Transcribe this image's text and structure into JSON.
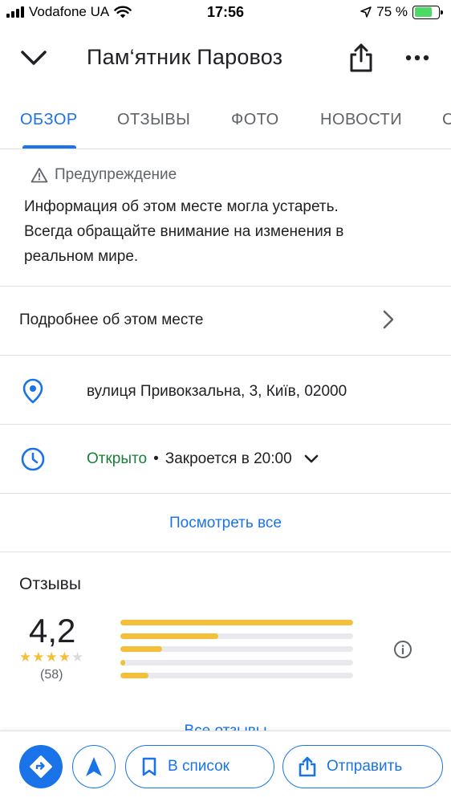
{
  "status_bar": {
    "carrier": "Vodafone UA",
    "time": "17:56",
    "battery_percent": "75 %",
    "battery_level": 0.75
  },
  "header": {
    "title": "Пам‘ятник Паровоз",
    "icons": [
      "chevron-down-icon",
      "share-icon",
      "more-icon"
    ]
  },
  "tabs": [
    {
      "label": "ОБЗОР",
      "active": true
    },
    {
      "label": "ОТЗЫВЫ",
      "active": false
    },
    {
      "label": "ФОТО",
      "active": false
    },
    {
      "label": "НОВОСТИ",
      "active": false
    },
    {
      "label": "С",
      "active": false
    }
  ],
  "warning": {
    "heading": "Предупреждение",
    "lines": [
      "Информация об этом месте могла устареть.",
      "Всегда обращайте внимание на изменения в",
      "реальном мире."
    ]
  },
  "details": {
    "more_label": "Подробнее об этом месте",
    "address": "вулиця Привокзальна, 3, Київ, 02000",
    "hours_status": "Открыто",
    "hours_separator": "•",
    "hours_close": "Закроется в 20:00",
    "see_all": "Посмотреть все"
  },
  "reviews": {
    "title": "Отзывы",
    "rating": "4,2",
    "rating_value": 4.2,
    "count": "(58)",
    "distribution": [
      {
        "stars": 5,
        "fraction": 1.0
      },
      {
        "stars": 4,
        "fraction": 0.42
      },
      {
        "stars": 3,
        "fraction": 0.18
      },
      {
        "stars": 2,
        "fraction": 0.02
      },
      {
        "stars": 1,
        "fraction": 0.12
      }
    ],
    "all_reviews": "Все отзывы"
  },
  "actions": {
    "save_label": "В список",
    "send_label": "Отправить"
  },
  "colors": {
    "accent": "#1a73e8",
    "open": "#188038",
    "star": "#f4bf3a"
  }
}
